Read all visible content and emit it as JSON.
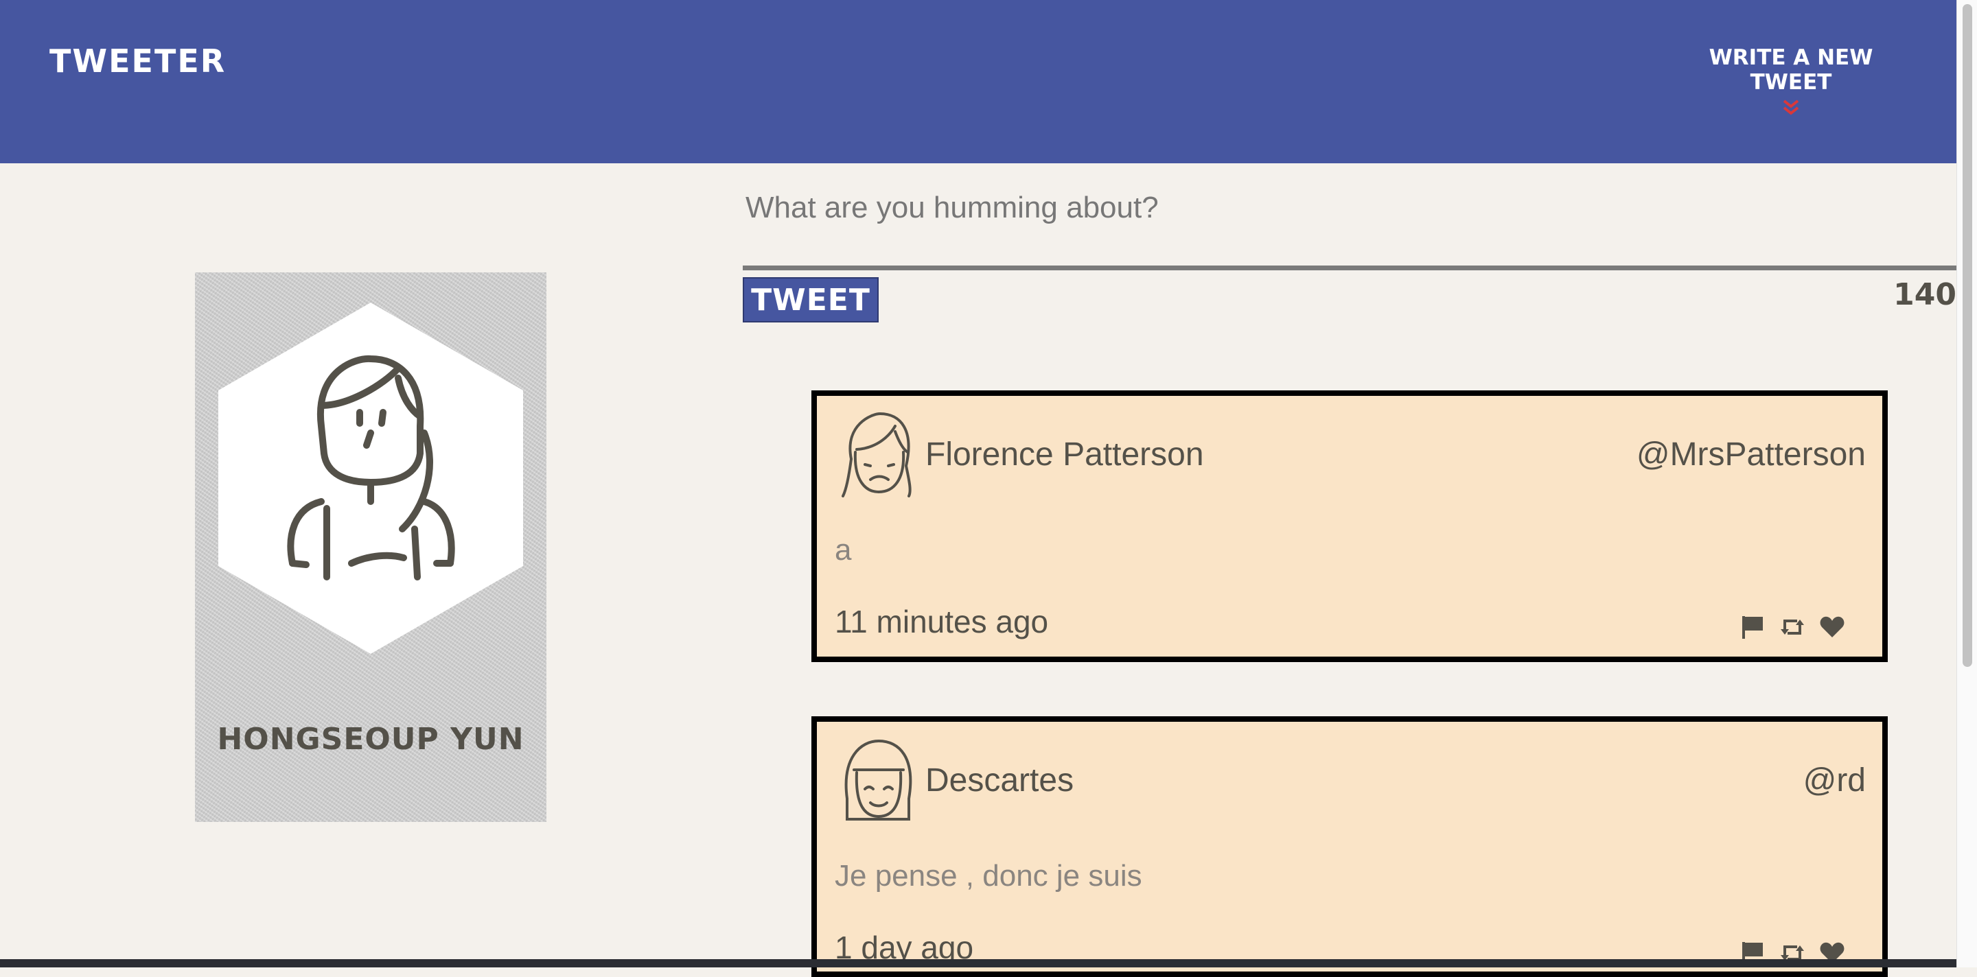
{
  "nav": {
    "brand": "TWEETER",
    "compose_label": "WRITE A NEW TWEET"
  },
  "profile": {
    "name": "HONGSEOUP YUN",
    "avatar_icon": "user-avatar-icon"
  },
  "composer": {
    "placeholder": "What are you humming about?",
    "value": "",
    "submit_label": "TWEET",
    "char_count": "140"
  },
  "tweets": [
    {
      "name": "Florence Patterson",
      "handle": "@MrsPatterson",
      "content": "a",
      "time": "11 minutes ago",
      "avatar_icon": "woman-avatar-icon"
    },
    {
      "name": "Descartes",
      "handle": "@rd",
      "content": "Je pense , donc je suis",
      "time": "1 day ago",
      "avatar_icon": "smiling-avatar-icon"
    }
  ],
  "icons": {
    "flag": "flag-icon",
    "retweet": "retweet-icon",
    "like": "heart-icon"
  },
  "colors": {
    "nav_bg": "#4656a0",
    "page_bg": "#f4f1ec",
    "tweet_bg": "#fae4c7",
    "accent_red": "#d9383a",
    "text": "#545149"
  }
}
